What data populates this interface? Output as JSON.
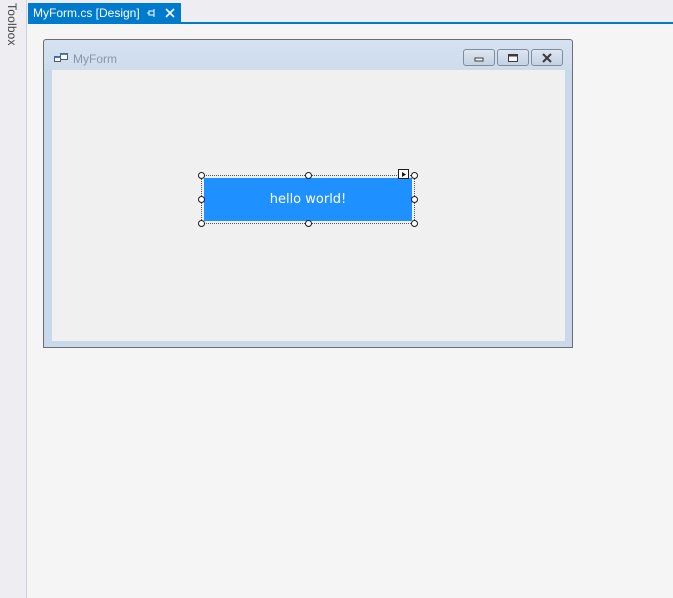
{
  "toolbox": {
    "label": "Toolbox"
  },
  "tab": {
    "label": "MyForm.cs [Design]",
    "pin_icon": "pin-icon",
    "close_icon": "close-icon"
  },
  "form": {
    "title": "MyForm",
    "icon": "form-app-icon",
    "caption_buttons": [
      "minimize",
      "maximize",
      "close"
    ]
  },
  "button": {
    "label": "hello world!",
    "color": "#1e90ff"
  },
  "colors": {
    "accent": "#007acc",
    "surface": "#f5f5f5",
    "form_frame": "#c9d8ea",
    "form_client": "#f0f0f0"
  }
}
